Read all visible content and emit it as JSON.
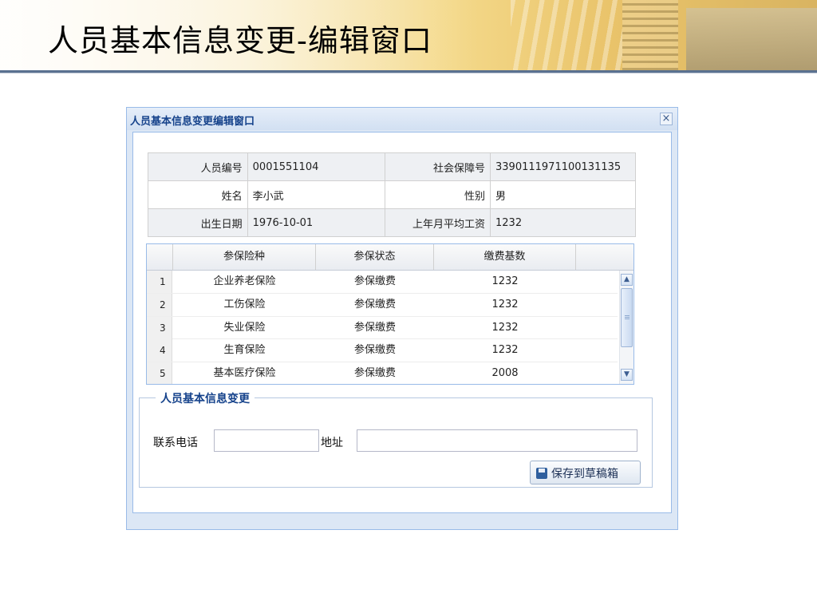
{
  "slide": {
    "title": "人员基本信息变更-编辑窗口"
  },
  "dialog": {
    "title": "人员基本信息变更编辑窗口",
    "close_glyph": "×",
    "info": {
      "rows": [
        {
          "label1": "人员编号",
          "value1": "0001551104",
          "label2": "社会保障号",
          "value2": "3390111971100131135"
        },
        {
          "label1": "姓名",
          "value1": "李小武",
          "label2": "性别",
          "value2": "男"
        },
        {
          "label1": "出生日期",
          "value1": "1976-10-01",
          "label2": "上年月平均工资",
          "value2": "1232"
        }
      ]
    },
    "grid": {
      "headers": [
        "参保险种",
        "参保状态",
        "缴费基数"
      ],
      "rows": [
        {
          "num": "1",
          "type": "企业养老保险",
          "status": "参保缴费",
          "base": "1232"
        },
        {
          "num": "2",
          "type": "工伤保险",
          "status": "参保缴费",
          "base": "1232"
        },
        {
          "num": "3",
          "type": "失业保险",
          "status": "参保缴费",
          "base": "1232"
        },
        {
          "num": "4",
          "type": "生育保险",
          "status": "参保缴费",
          "base": "1232"
        },
        {
          "num": "5",
          "type": "基本医疗保险",
          "status": "参保缴费",
          "base": "2008"
        }
      ],
      "scroll_up_glyph": "▲",
      "scroll_down_glyph": "▼"
    },
    "change_form": {
      "legend": "人员基本信息变更",
      "phone_label": "联系电话",
      "phone_value": "",
      "address_label": "地址",
      "address_value": "",
      "save_label": "保存到草稿箱"
    }
  },
  "icons": {
    "close": "close-icon",
    "save": "save-icon",
    "scroll_up": "chevron-up-icon",
    "scroll_down": "chevron-down-icon"
  },
  "colors": {
    "dialog_title": "#15428b",
    "dialog_border": "#99bbe8",
    "dialog_bg": "#dce7f5"
  }
}
